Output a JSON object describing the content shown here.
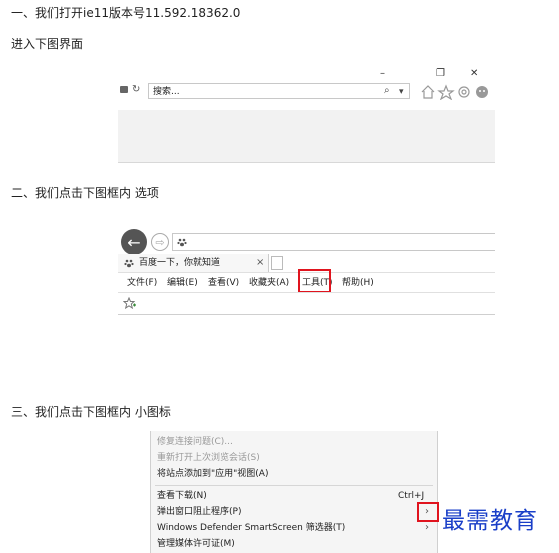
{
  "steps": {
    "step1": "一、我们打开ie11版本号11.592.18362.0",
    "step1_sub": "进入下图界面",
    "step2": "二、我们点击下图框内 选项",
    "step3": "三、我们点击下图框内 小图标"
  },
  "shot1": {
    "search_placeholder": "搜索...",
    "minimize": "–",
    "restore": "❐",
    "close": "✕",
    "lock": "🔒",
    "refresh": "↻",
    "search_glyph": "⌕",
    "dropdown": "▾"
  },
  "shot2": {
    "back": "←",
    "forward": "⇨",
    "tab_title": "百度一下，你就知道",
    "tab_close": "×",
    "menu": [
      "文件(F)",
      "编辑(E)",
      "查看(V)",
      "收藏夹(A)",
      "工具(T)",
      "帮助(H)"
    ],
    "highlight_color": "#e0141e"
  },
  "shot3": {
    "items": [
      {
        "label": "修复连接问题(C)...",
        "shortcut": "",
        "disabled": true
      },
      {
        "label": "重新打开上次浏览会话(S)",
        "shortcut": "",
        "disabled": true
      },
      {
        "label": "将站点添加到\"应用\"视图(A)",
        "shortcut": "",
        "disabled": false
      },
      {
        "label": "查看下载(N)",
        "shortcut": "Ctrl+J",
        "disabled": false
      },
      {
        "label": "弹出窗口阻止程序(P)",
        "shortcut": "",
        "disabled": false
      },
      {
        "label": "Windows Defender SmartScreen 筛选器(T)",
        "shortcut": "",
        "disabled": false
      },
      {
        "label": "管理媒体许可证(M)",
        "shortcut": "",
        "disabled": false
      }
    ],
    "submenu_arrow": "›"
  },
  "watermark": "最需教育"
}
